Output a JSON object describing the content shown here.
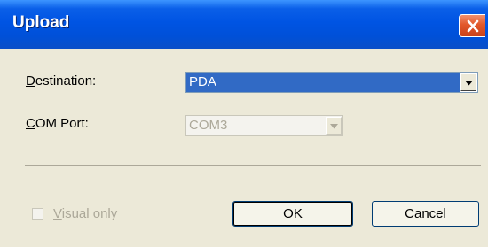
{
  "window": {
    "title": "Upload"
  },
  "destination": {
    "label_mnemonic": "D",
    "label_rest": "estination:",
    "value": "PDA"
  },
  "com_port": {
    "label_mnemonic": "C",
    "label_rest": "OM Port:",
    "value": "COM3",
    "enabled": false
  },
  "visual_only": {
    "label_mnemonic": "V",
    "label_rest": "isual only",
    "checked": false,
    "enabled": false
  },
  "buttons": {
    "ok_label": "OK",
    "cancel_label": "Cancel"
  },
  "icons": {
    "close": "close-icon",
    "dropdown": "chevron-down-icon"
  },
  "colors": {
    "titlebar": "#0054e3",
    "selection": "#316ac5",
    "dialog_bg": "#ece9d8",
    "close_button": "#e2582a"
  }
}
